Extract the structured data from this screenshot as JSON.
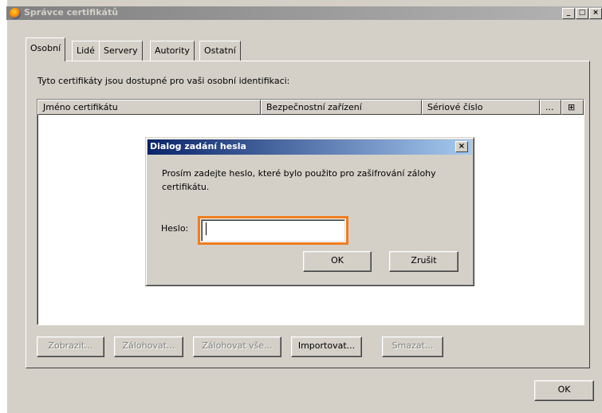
{
  "window": {
    "title": "Správce certifikátů",
    "controls": [
      "_",
      "□",
      "×"
    ]
  },
  "tabs": [
    "Osobní",
    "Lidé",
    "Servery",
    "Autority",
    "Ostatní"
  ],
  "active_tab": "Osobní",
  "description": "Tyto certifikáty jsou dostupné pro vaši osobní identifikaci:",
  "table": {
    "columns": [
      "Jméno certifikátu",
      "Bezpečnostní zařízení",
      "Sériové číslo",
      "..."
    ],
    "column_picker": "⊞",
    "rows": []
  },
  "buttons": {
    "view": "Zobrazit...",
    "backup": "Zálohovat...",
    "backup_all": "Zálohovat vše...",
    "import": "Importovat...",
    "delete": "Smazat..."
  },
  "ok_label": "OK",
  "dialog": {
    "title": "Dialog zadání hesla",
    "close": "×",
    "message": "Prosím zadejte heslo, které bylo použito pro zašifrování zálohy certifikátu.",
    "password_label": "Heslo:",
    "password_value": "",
    "ok": "OK",
    "cancel": "Zrušit"
  }
}
